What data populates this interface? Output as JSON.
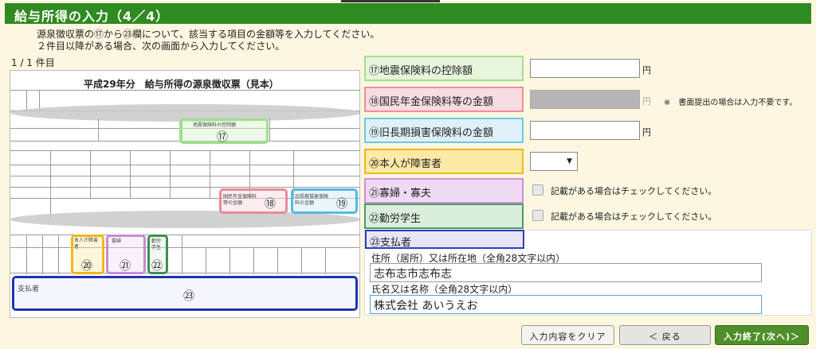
{
  "header": {
    "title": "給与所得の入力（4／4）"
  },
  "instructions": {
    "line1": "源泉徴収票の⑰から㉓欄について、該当する項目の金額等を入力してください。",
    "line2": "２件目以降がある場合、次の画面から入力してください。"
  },
  "record_count": "1 / 1 件目",
  "form_image": {
    "title": "平成29年分　給与所得の源泉徴収票（見本）",
    "markers": {
      "m17": "⑰",
      "m18": "⑱",
      "m19": "⑲",
      "m20": "⑳",
      "m21": "㉑",
      "m22": "㉒",
      "m23": "㉓"
    },
    "captions": {
      "c17": "地震保険料の控除額",
      "c18": "国民年金保険料等の金額",
      "c19": "旧長期損害保険料の金額",
      "c20": "本人が障害者",
      "c21": "寡婦",
      "c22": "勤労学生",
      "c23": "支払者"
    }
  },
  "fields": {
    "f17": {
      "label": "⑰地震保険料の控除額",
      "unit": "円",
      "value": ""
    },
    "f18": {
      "label": "⑱国民年金保険料等の金額",
      "unit": "円",
      "note": "※　書面提出の場合は入力不要です。"
    },
    "f19": {
      "label": "⑲旧長期損害保険料の金額",
      "unit": "円",
      "value": ""
    },
    "f20": {
      "label": "⑳本人が障害者",
      "selected": ""
    },
    "f21": {
      "label": "㉑寡婦・寡夫",
      "check_label": "記載がある場合はチェックしてください。"
    },
    "f22": {
      "label": "㉒勤労学生",
      "check_label": "記載がある場合はチェックしてください。"
    },
    "f23": {
      "label": "㉓支払者",
      "address_label": "住所（居所）又は所在地（全角28文字以内）",
      "address_value": "志布志市志布志",
      "name_label": "氏名又は名称（全角28文字以内）",
      "name_value": "株式会社 あいうえお"
    }
  },
  "buttons": {
    "clear": "入力内容をクリア",
    "back": "＜ 戻る",
    "finish": "入力終了(次へ)＞"
  },
  "colors": {
    "header_green": "#2f8a1f",
    "background": "#fdf7e1",
    "finish_green": "#4f8f2a"
  }
}
